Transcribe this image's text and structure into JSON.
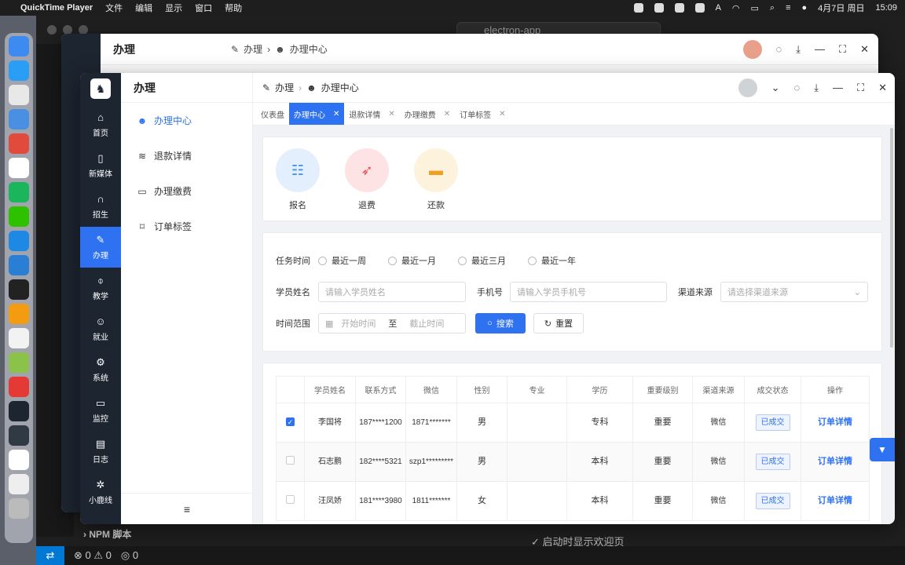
{
  "menubar": {
    "app": "QuickTime Player",
    "items": [
      "文件",
      "编辑",
      "显示",
      "窗口",
      "帮助"
    ],
    "date": "4月7日 周日",
    "time": "15:09",
    "input_method": "A"
  },
  "vscode": {
    "search": "electron-app",
    "npm_label": "NPM 脚本",
    "overlay_text": "启动时显示欢迎页",
    "status": {
      "errors": "0",
      "warnings": "0",
      "ports": "0"
    },
    "badge": "1"
  },
  "back_window": {
    "title": "办理",
    "breadcrumb": [
      "办理",
      "办理中心"
    ]
  },
  "nav": {
    "items": [
      {
        "label": "首页",
        "icon": "home-icon",
        "glyph": "⌂"
      },
      {
        "label": "新媒体",
        "icon": "tablet-icon",
        "glyph": "▯"
      },
      {
        "label": "招生",
        "icon": "headset-icon",
        "glyph": "∩"
      },
      {
        "label": "办理",
        "icon": "edit-icon",
        "glyph": "✎"
      },
      {
        "label": "教学",
        "icon": "mic-icon",
        "glyph": "⌽"
      },
      {
        "label": "就业",
        "icon": "user-icon",
        "glyph": "☺"
      },
      {
        "label": "系统",
        "icon": "gear-icon",
        "glyph": "⚙"
      },
      {
        "label": "监控",
        "icon": "monitor-icon",
        "glyph": "▭"
      },
      {
        "label": "日志",
        "icon": "log-icon",
        "glyph": "▤"
      },
      {
        "label": "小鹿线",
        "icon": "bug-icon",
        "glyph": "✲"
      }
    ]
  },
  "sub": {
    "title": "办理",
    "items": [
      {
        "label": "办理中心",
        "icon": "user-icon",
        "glyph": "☻"
      },
      {
        "label": "退款详情",
        "icon": "database-icon",
        "glyph": "≋"
      },
      {
        "label": "办理缴费",
        "icon": "card-icon",
        "glyph": "▭"
      },
      {
        "label": "订单标签",
        "icon": "bookmark-icon",
        "glyph": "⌑"
      }
    ]
  },
  "header": {
    "breadcrumb": [
      "办理",
      "办理中心"
    ]
  },
  "tabs": [
    {
      "label": "仪表盘"
    },
    {
      "label": "办理中心"
    },
    {
      "label": "退款详情"
    },
    {
      "label": "办理缴费"
    },
    {
      "label": "订单标签"
    }
  ],
  "quick": [
    {
      "label": "报名",
      "icon": "user-card-icon",
      "color": "#e3effd",
      "fg": "#3d8bf0",
      "glyph": "☷"
    },
    {
      "label": "退费",
      "icon": "rocket-icon",
      "color": "#fde3e3",
      "fg": "#e84b4b",
      "glyph": "➶"
    },
    {
      "label": "还款",
      "icon": "card-icon",
      "color": "#fdf3dc",
      "fg": "#f0a020",
      "glyph": "▬"
    }
  ],
  "filters": {
    "time_label": "任务时间",
    "time_options": [
      "最近一周",
      "最近一月",
      "最近三月",
      "最近一年"
    ],
    "name_label": "学员姓名",
    "name_placeholder": "请输入学员姓名",
    "phone_label": "手机号",
    "phone_placeholder": "请输入学员手机号",
    "channel_label": "渠道来源",
    "channel_placeholder": "请选择渠道来源",
    "range_label": "时间范围",
    "start_placeholder": "开始时间",
    "to": "至",
    "end_placeholder": "截止时间",
    "search_btn": "搜索",
    "reset_btn": "重置"
  },
  "table": {
    "headers": [
      "学员姓名",
      "联系方式",
      "微信",
      "性别",
      "专业",
      "学历",
      "重要级别",
      "渠道来源",
      "成交状态",
      "操作"
    ],
    "rows": [
      {
        "checked": true,
        "name": "李国将",
        "phone": "187****1200",
        "wechat": "1871*******",
        "gender": "男",
        "major": "",
        "edu": "专科",
        "level": "重要",
        "channel": "微信",
        "status": "已成交",
        "action": "订单详情"
      },
      {
        "checked": false,
        "name": "石志鹏",
        "phone": "182****5321",
        "wechat": "szp1*********",
        "gender": "男",
        "major": "",
        "edu": "本科",
        "level": "重要",
        "channel": "微信",
        "status": "已成交",
        "action": "订单详情"
      },
      {
        "checked": false,
        "name": "汪凤娇",
        "phone": "181****3980",
        "wechat": "1811*******",
        "gender": "女",
        "major": "",
        "edu": "本科",
        "level": "重要",
        "channel": "微信",
        "status": "已成交",
        "action": "订单详情"
      }
    ]
  },
  "colors": {
    "primary": "#2e72f1",
    "nav_bg": "#1d2530"
  }
}
